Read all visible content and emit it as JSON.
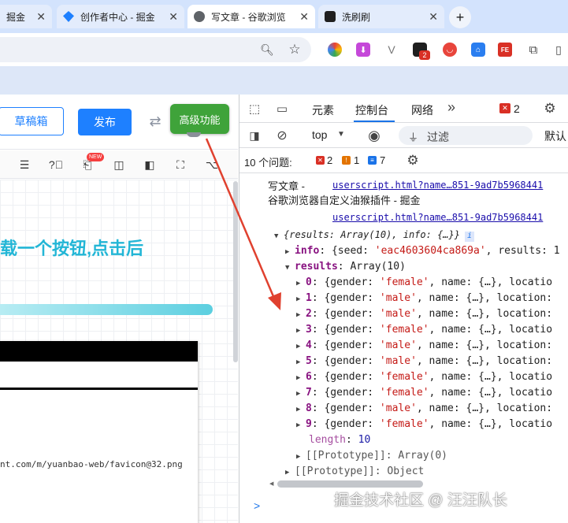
{
  "tabs": [
    {
      "label": "掘金",
      "active": false
    },
    {
      "label": "创作者中心 - 掘金",
      "active": false
    },
    {
      "label": "写文章 - 谷歌浏览",
      "active": true
    },
    {
      "label": "洗刷刷",
      "active": false
    }
  ],
  "new_tab_symbol": "+",
  "editor": {
    "drafts_button": "草稿箱",
    "publish_button": "发布",
    "advanced_button": "高级功能",
    "heading_fragment": "载一个按钮,点击后",
    "badge_new": "NEW",
    "url_fragment": "nt.com/m/yuanbao-web/favicon@32.png"
  },
  "devtools": {
    "tabs": [
      "元素",
      "控制台",
      "网络"
    ],
    "active_tab": "控制台",
    "error_count": "2",
    "more_label": "»",
    "context": "top",
    "filter_placeholder": "过滤",
    "default_levels": "默认",
    "issues_label": "10 个问题:",
    "issues": {
      "errors": "2",
      "warnings": "1",
      "info": "7"
    },
    "log_text_1": "写文章 -",
    "log_text_2": "谷歌浏览器自定义油猴插件 - 掘金",
    "source_link": "userscript.html?name…851-9ad7b5968441",
    "source_link_2": "userscript.html?name…851-9ad7b5968441",
    "object_summary": "{results: Array(10), info: {…}}",
    "info_badge": "i",
    "info_line": {
      "key": "info",
      "seed": "eac4603604ca869a",
      "rest": "results: 1"
    },
    "results_label": "results",
    "results_type": "Array(10)",
    "results": [
      {
        "index": "0",
        "gender": "female"
      },
      {
        "index": "1",
        "gender": "male"
      },
      {
        "index": "2",
        "gender": "male"
      },
      {
        "index": "3",
        "gender": "female"
      },
      {
        "index": "4",
        "gender": "male"
      },
      {
        "index": "5",
        "gender": "male"
      },
      {
        "index": "6",
        "gender": "female"
      },
      {
        "index": "7",
        "gender": "female"
      },
      {
        "index": "8",
        "gender": "male"
      },
      {
        "index": "9",
        "gender": "female"
      }
    ],
    "length_key": "length",
    "length_value": "10",
    "proto_array": "[[Prototype]]: Array(0)",
    "proto_object": "[[Prototype]]: Object",
    "prompt": ">"
  },
  "watermark": "掘金技术社区 @ 汪汪队长",
  "colors": {
    "accent": "#1e80ff",
    "green": "#3fa33a",
    "arrow": "#e0412f",
    "tabbar": "#d3e3fd"
  }
}
